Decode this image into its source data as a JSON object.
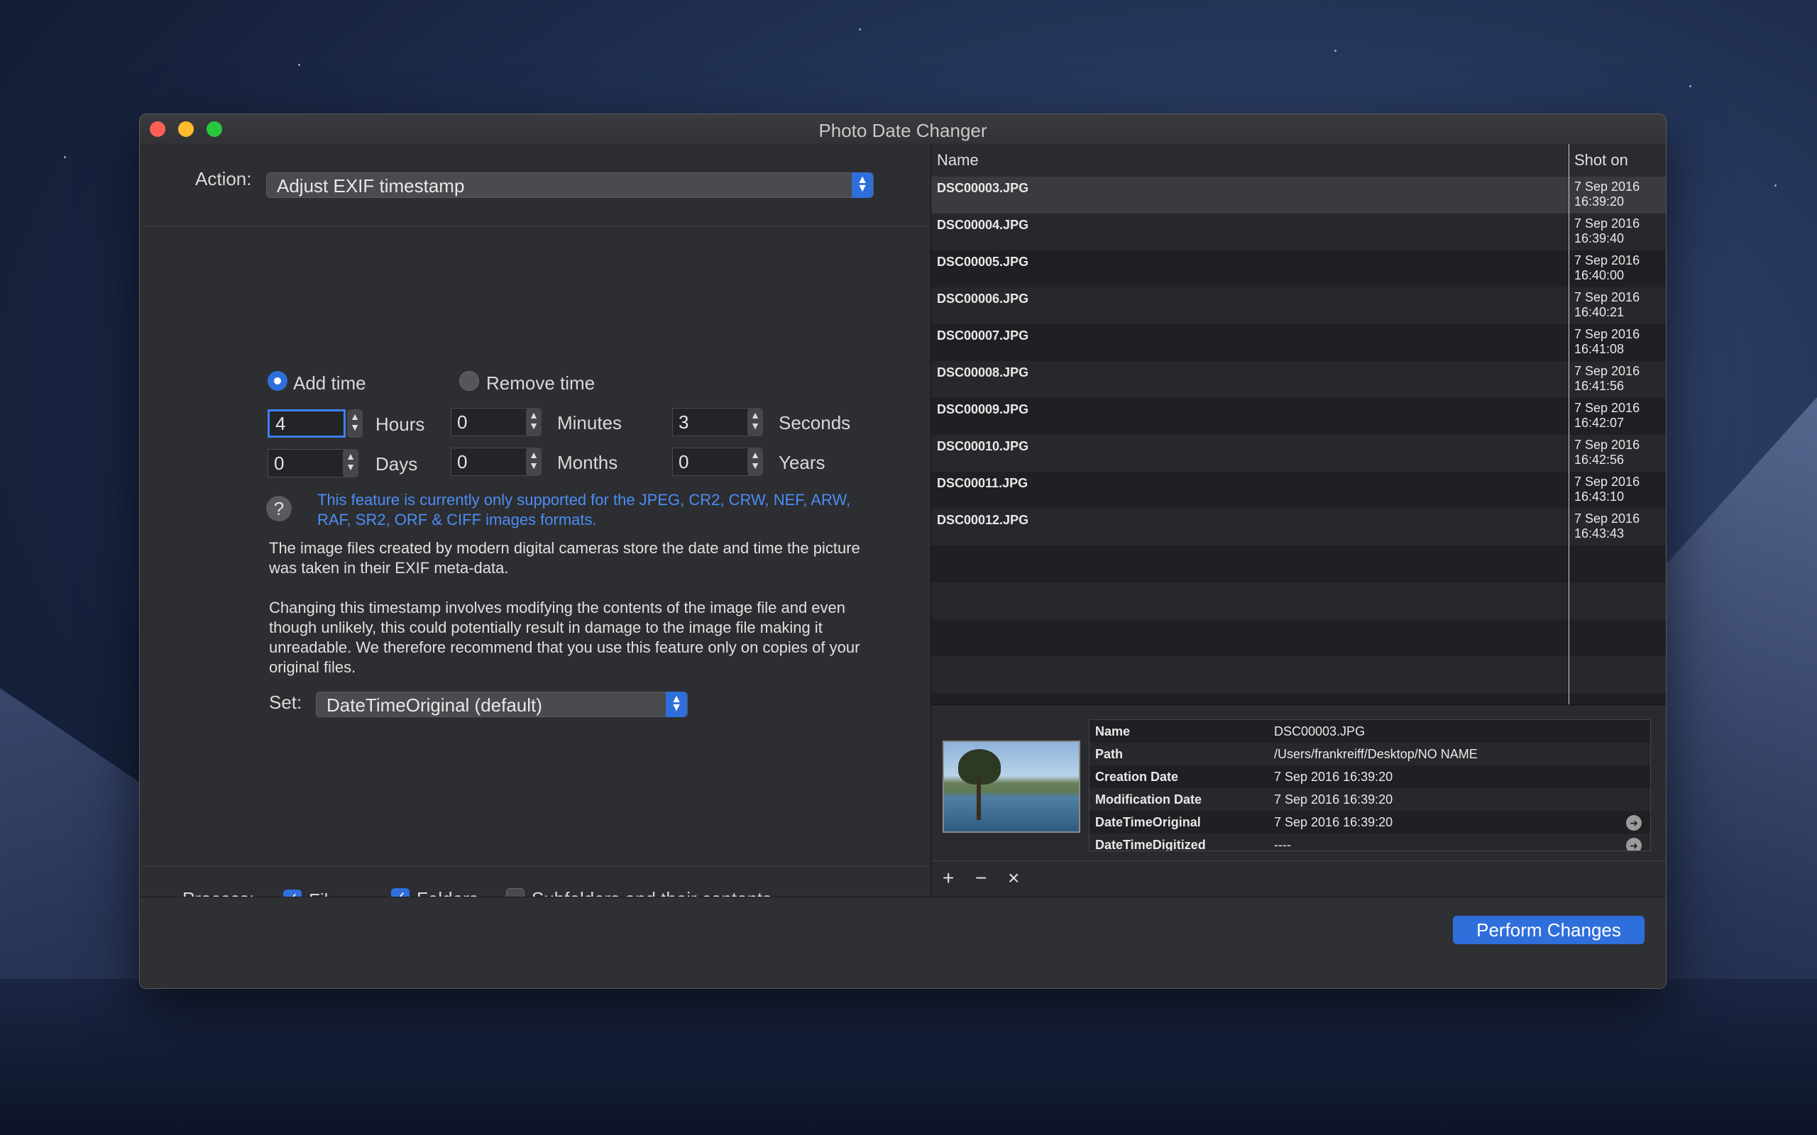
{
  "window": {
    "title": "Photo Date Changer"
  },
  "action": {
    "label": "Action:",
    "value": "Adjust EXIF timestamp"
  },
  "mode": {
    "add_label": "Add time",
    "remove_label": "Remove time",
    "selected": "add"
  },
  "time": {
    "hours": "4",
    "hours_label": "Hours",
    "minutes": "0",
    "minutes_label": "Minutes",
    "seconds": "3",
    "seconds_label": "Seconds",
    "days": "0",
    "days_label": "Days",
    "months": "0",
    "months_label": "Months",
    "years": "0",
    "years_label": "Years"
  },
  "help_glyph": "?",
  "note": "This feature is currently only supported for the JPEG, CR2, CRW, NEF, ARW, RAF, SR2, ORF & CIFF images formats.",
  "para1": "The image files created by modern digital cameras store the date and time the picture was taken in their EXIF meta-data.",
  "para2": "Changing this timestamp involves modifying the contents of the image file and even though unlikely, this could potentially result in damage to the image file making it unreadable. We therefore recommend that you use this feature only on copies of your original files.",
  "set": {
    "label": "Set:",
    "value": "DateTimeOriginal (default)"
  },
  "process": {
    "label": "Process:",
    "files": "Files",
    "folders": "Folders",
    "subfolders": "Subfolders and their contents",
    "files_checked": true,
    "folders_checked": true,
    "subfolders_checked": false
  },
  "table": {
    "col_name": "Name",
    "col_shot": "Shot on",
    "rows": [
      {
        "name": "DSC00003.JPG",
        "date": "7 Sep 2016",
        "time": "16:39:20"
      },
      {
        "name": "DSC00004.JPG",
        "date": "7 Sep 2016",
        "time": "16:39:40"
      },
      {
        "name": "DSC00005.JPG",
        "date": "7 Sep 2016",
        "time": "16:40:00"
      },
      {
        "name": "DSC00006.JPG",
        "date": "7 Sep 2016",
        "time": "16:40:21"
      },
      {
        "name": "DSC00007.JPG",
        "date": "7 Sep 2016",
        "time": "16:41:08"
      },
      {
        "name": "DSC00008.JPG",
        "date": "7 Sep 2016",
        "time": "16:41:56"
      },
      {
        "name": "DSC00009.JPG",
        "date": "7 Sep 2016",
        "time": "16:42:07"
      },
      {
        "name": "DSC00010.JPG",
        "date": "7 Sep 2016",
        "time": "16:42:56"
      },
      {
        "name": "DSC00011.JPG",
        "date": "7 Sep 2016",
        "time": "16:43:10"
      },
      {
        "name": "DSC00012.JPG",
        "date": "7 Sep 2016",
        "time": "16:43:43"
      }
    ]
  },
  "props": [
    {
      "key": "Name",
      "value": "DSC00003.JPG",
      "arrow": false
    },
    {
      "key": "Path",
      "value": "/Users/frankreiff/Desktop/NO NAME",
      "arrow": false
    },
    {
      "key": "Creation Date",
      "value": "7 Sep 2016 16:39:20",
      "arrow": false
    },
    {
      "key": "Modification Date",
      "value": "7 Sep 2016 16:39:20",
      "arrow": false
    },
    {
      "key": "DateTimeOriginal",
      "value": "7 Sep 2016 16:39:20",
      "arrow": true
    },
    {
      "key": "DateTimeDigitized",
      "value": "----",
      "arrow": true
    }
  ],
  "tools": {
    "add": "+",
    "remove": "−",
    "clear": "×"
  },
  "perform_label": "Perform Changes",
  "colors": {
    "accent": "#2f6fdb",
    "note_text": "#4b8df5",
    "selected_row": "#3a3b3e"
  }
}
